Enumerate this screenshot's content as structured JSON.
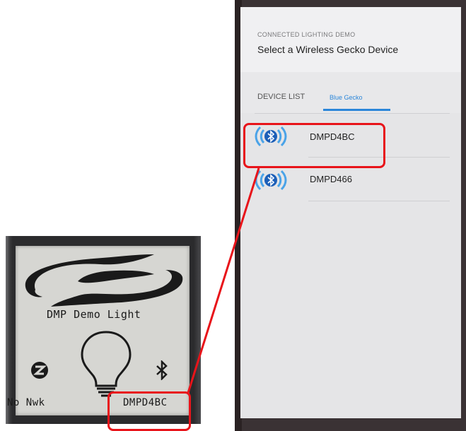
{
  "lcd": {
    "title": "DMP Demo Light",
    "network_status": "No Nwk",
    "device_name": "DMPD4BC"
  },
  "app": {
    "header_subtitle": "CONNECTED LIGHTING DEMO",
    "header_title": "Select a Wireless Gecko Device",
    "tabs": [
      {
        "label": "DEVICE LIST",
        "active": false
      },
      {
        "label": "Blue Gecko",
        "active": true
      }
    ],
    "devices": [
      {
        "name": "DMPD4BC",
        "icon": "bluetooth-icon",
        "highlighted": true
      },
      {
        "name": "DMPD466",
        "icon": "bluetooth-icon",
        "highlighted": false
      }
    ]
  },
  "colors": {
    "highlight": "#e8141a",
    "accent": "#2b86d9",
    "bt_blue": "#1c5fb8"
  }
}
